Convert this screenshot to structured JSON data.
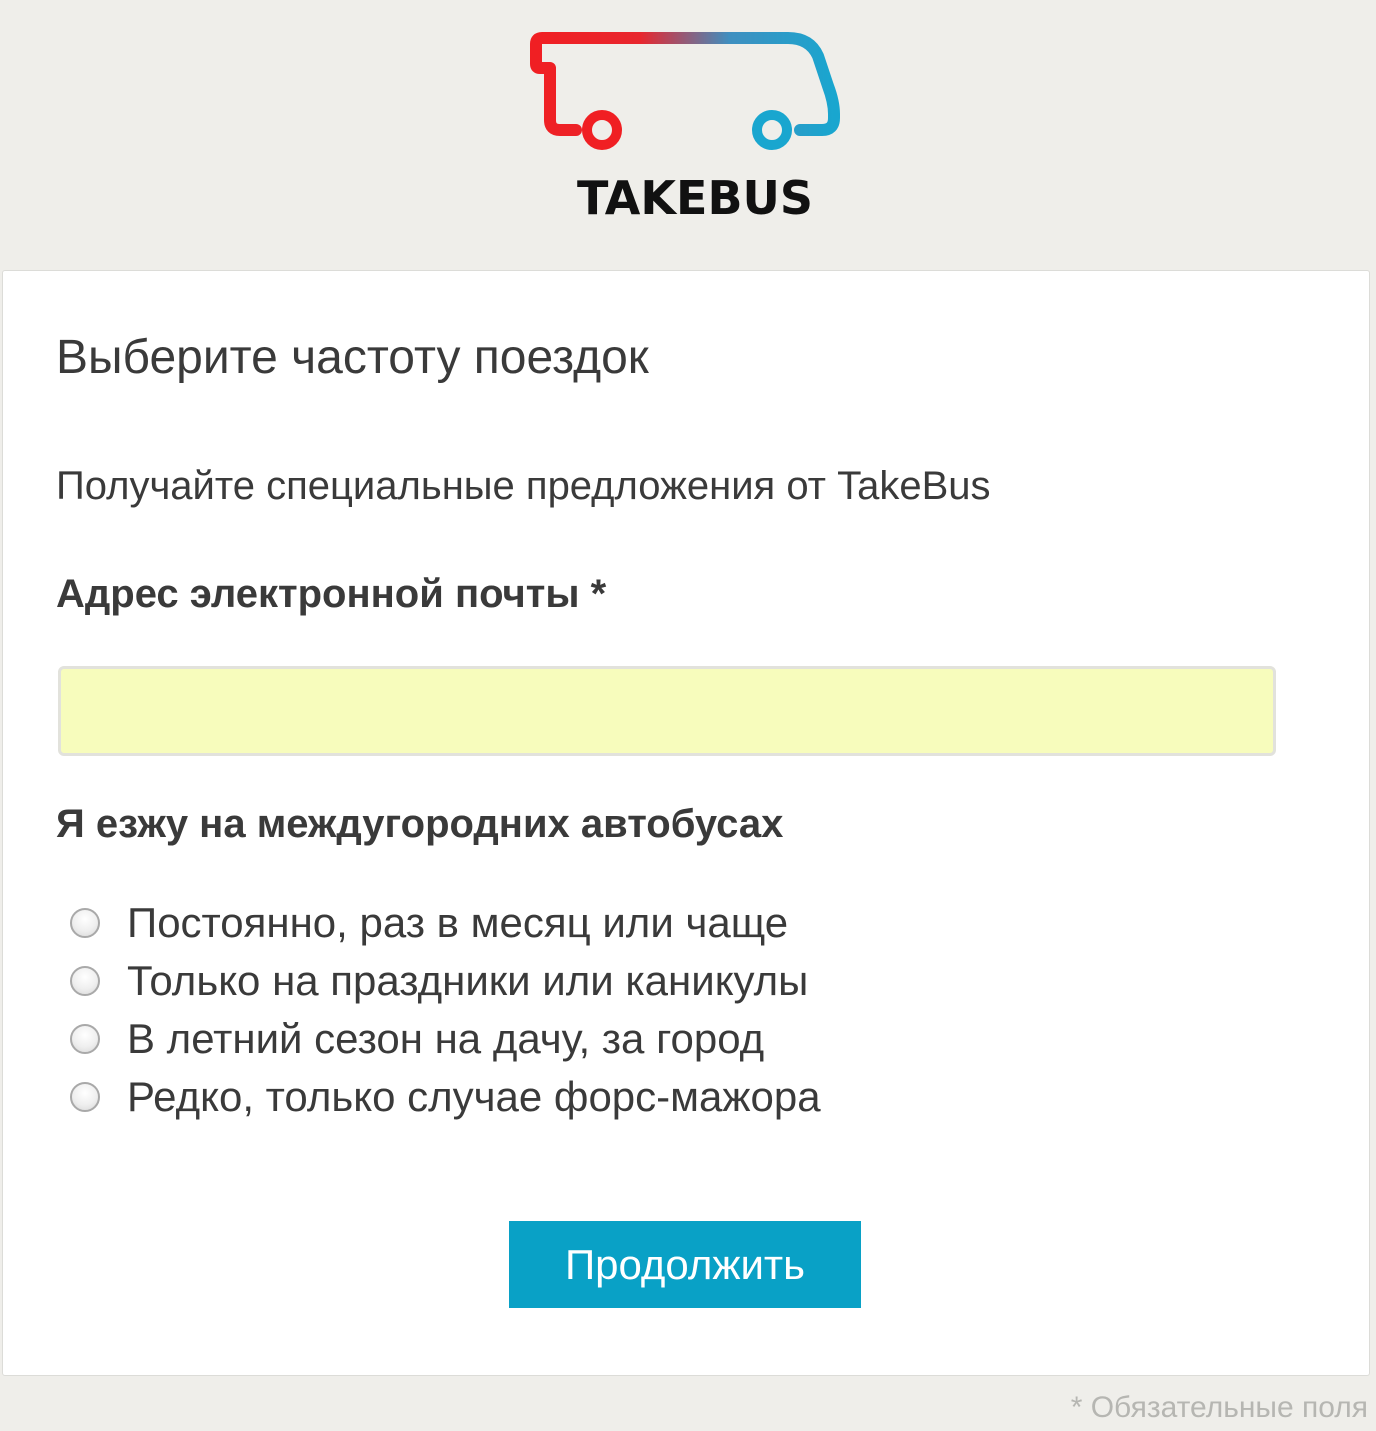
{
  "brand": {
    "name": "TAKEBUS",
    "logo_icon": "bus-icon",
    "gradient_start": "#f01f23",
    "gradient_end": "#19a6cf"
  },
  "form": {
    "title": "Выберите частоту поездок",
    "subtitle": "Получайте специальные предложения от TakeBus",
    "email": {
      "label": "Адрес электронной почты *",
      "value": "",
      "background": "#f7fcbc"
    },
    "frequency": {
      "label": "Я езжу на междугородних автобусах",
      "options": [
        {
          "label": "Постоянно, раз в месяц или чаще",
          "selected": false
        },
        {
          "label": "Только на праздники или каникулы",
          "selected": false
        },
        {
          "label": "В летний сезон на дачу, за город",
          "selected": false
        },
        {
          "label": "Редко, только случае форс-мажора",
          "selected": false
        }
      ]
    },
    "submit_label": "Продолжить",
    "submit_color": "#09a1c6"
  },
  "footer": {
    "required_note": "* Обязательные поля"
  }
}
